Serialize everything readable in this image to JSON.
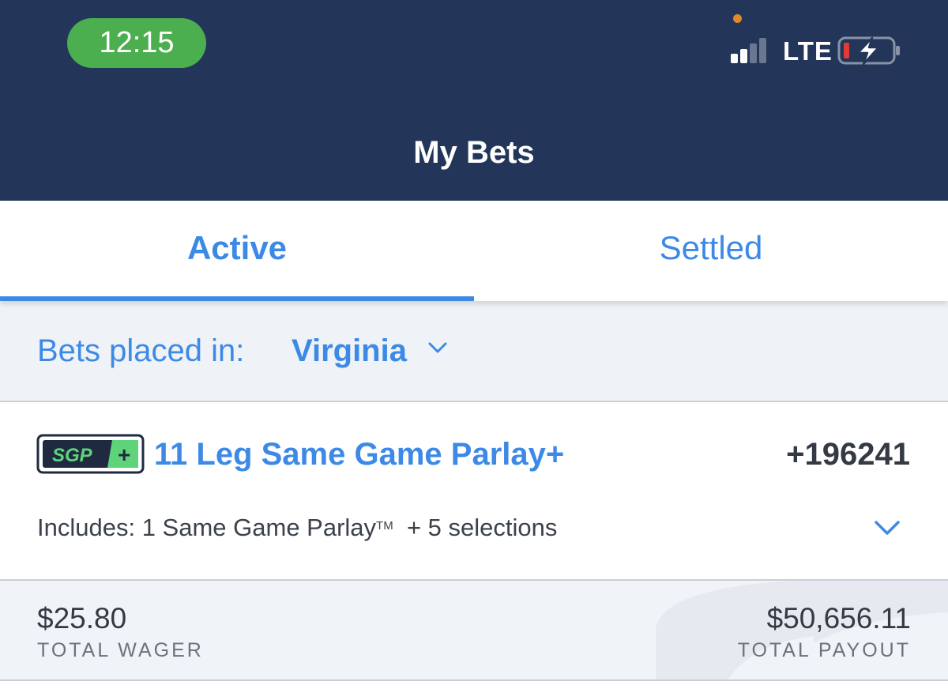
{
  "status_bar": {
    "time": "12:15",
    "network": "LTE",
    "colors": {
      "clock_pill": "#4caf4f",
      "battery_low": "#e53935",
      "mic_indicator": "#e08a2c"
    }
  },
  "header": {
    "title": "My Bets",
    "background": "#233659"
  },
  "tabs": [
    {
      "label": "Active",
      "selected": true
    },
    {
      "label": "Settled",
      "selected": false
    }
  ],
  "filter": {
    "label": "Bets placed in:",
    "value": "Virginia"
  },
  "bet": {
    "badge_text": "SGP",
    "badge_plus": "+",
    "title": "11 Leg Same Game Parlay+",
    "odds": "+196241",
    "includes_prefix": "Includes: 1 Same Game Parlay",
    "includes_tm": "TM",
    "includes_suffix": "+ 5 selections"
  },
  "totals": {
    "wager_amount": "$25.80",
    "wager_label": "TOTAL WAGER",
    "payout_amount": "$50,656.11",
    "payout_label": "TOTAL PAYOUT"
  },
  "accent_color": "#3d8ae6"
}
